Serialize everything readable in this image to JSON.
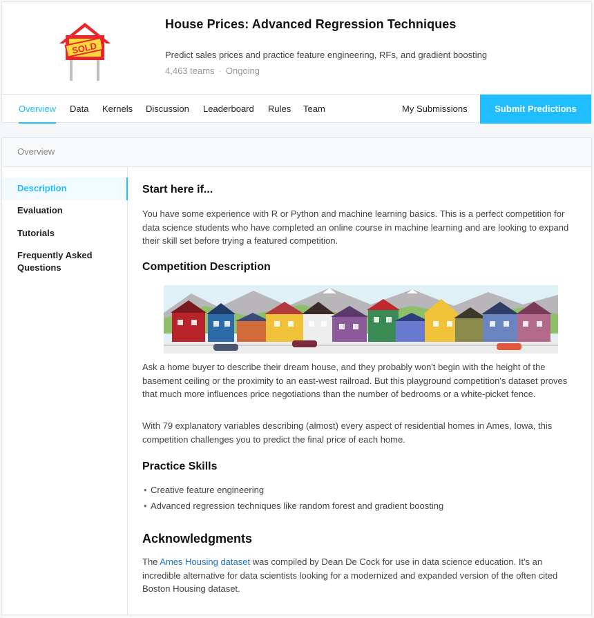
{
  "competition": {
    "title": "House Prices: Advanced Regression Techniques",
    "subtitle": "Predict sales prices and practice feature engineering, RFs, and gradient boosting",
    "teams": "4,463 teams",
    "separator": "·",
    "status": "Ongoing",
    "logo_text": "SOLD"
  },
  "tabs": [
    {
      "label": "Overview",
      "active": true
    },
    {
      "label": "Data"
    },
    {
      "label": "Kernels"
    },
    {
      "label": "Discussion"
    },
    {
      "label": "Leaderboard"
    },
    {
      "label": "Rules"
    },
    {
      "label": "Team"
    }
  ],
  "my_submissions": "My Submissions",
  "submit_label": "Submit Predictions",
  "panel_title": "Overview",
  "sidenav": [
    {
      "label": "Description",
      "active": true
    },
    {
      "label": "Evaluation"
    },
    {
      "label": "Tutorials"
    },
    {
      "label": "Frequently Asked Questions"
    }
  ],
  "content": {
    "start_heading": "Start here if...",
    "start_text": "You have some experience with R or Python and machine learning basics. This is a perfect competition for data science students who have completed an online course in machine learning and are looking to expand their skill set before trying a featured competition.",
    "desc_heading": "Competition Description",
    "desc_p1": "Ask a home buyer to describe their dream house, and they probably won't begin with the height of the basement ceiling or the proximity to an east-west railroad. But this playground competition's dataset proves that much more influences price negotiations than the number of bedrooms or a white-picket fence.",
    "desc_p2": "With 79 explanatory variables describing (almost) every aspect of residential homes in Ames, Iowa, this competition challenges you to predict the final price of each home.",
    "skills_heading": "Practice Skills",
    "skills": [
      "Creative feature engineering",
      "Advanced regression techniques like random forest and gradient boosting"
    ],
    "ack_heading": "Acknowledgments",
    "ack_pre": "The ",
    "ack_link": "Ames Housing dataset",
    "ack_post": " was compiled by Dean De Cock for use in data science education. It's an incredible alternative for data scientists looking for a modernized and expanded version of the often cited Boston Housing dataset."
  },
  "colors": {
    "accent": "#20beff",
    "link": "#1a73c9"
  }
}
